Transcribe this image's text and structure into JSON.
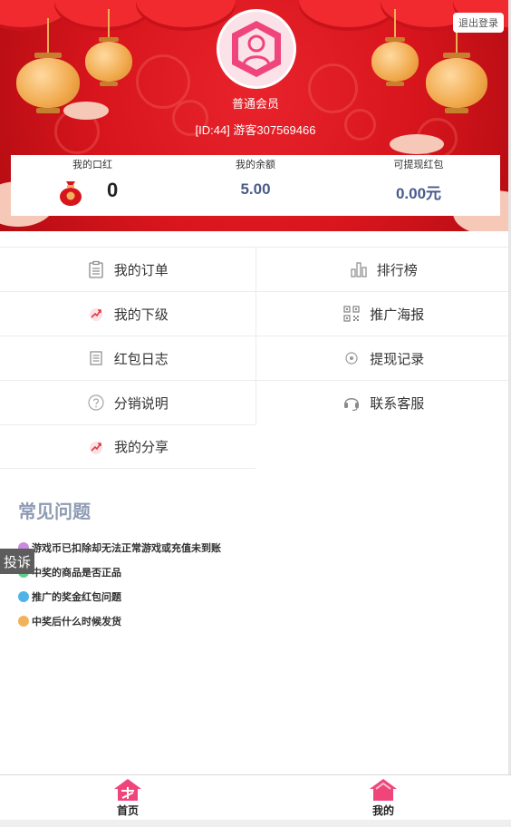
{
  "header": {
    "logout_label": "退出登录",
    "member_level": "普通会员",
    "member_id": "[ID:44] 游客307569466"
  },
  "stats": {
    "lipstick": {
      "label": "我的口红",
      "value": "0"
    },
    "balance": {
      "label": "我的余额",
      "value": "5.00"
    },
    "red_packet": {
      "label": "可提现红包",
      "value": "0.00元"
    }
  },
  "menu": {
    "orders": "我的订单",
    "ranking": "排行榜",
    "subordinates": "我的下级",
    "poster": "推广海报",
    "red_packet_log": "红包日志",
    "withdraw_records": "提现记录",
    "distribution_info": "分销说明",
    "customer_service": "联系客服",
    "my_share": "我的分享"
  },
  "faq": {
    "title": "常见问题",
    "items": [
      {
        "text": "游戏币已扣除却无法正常游戏或充值未到账",
        "color": "#c88be0"
      },
      {
        "text": "中奖的商品是否正品",
        "color": "#5fd08a"
      },
      {
        "text": "推广的奖金红包问题",
        "color": "#4fb3e6"
      },
      {
        "text": "中奖后什么时候发货",
        "color": "#f2b25c"
      }
    ]
  },
  "complaint_label": "投诉",
  "bottom_nav": {
    "home": "首页",
    "mine": "我的"
  },
  "colors": {
    "banner_red": "#d8151d",
    "accent_pink": "#f0457a",
    "stat_blue": "#4a5b8c"
  }
}
